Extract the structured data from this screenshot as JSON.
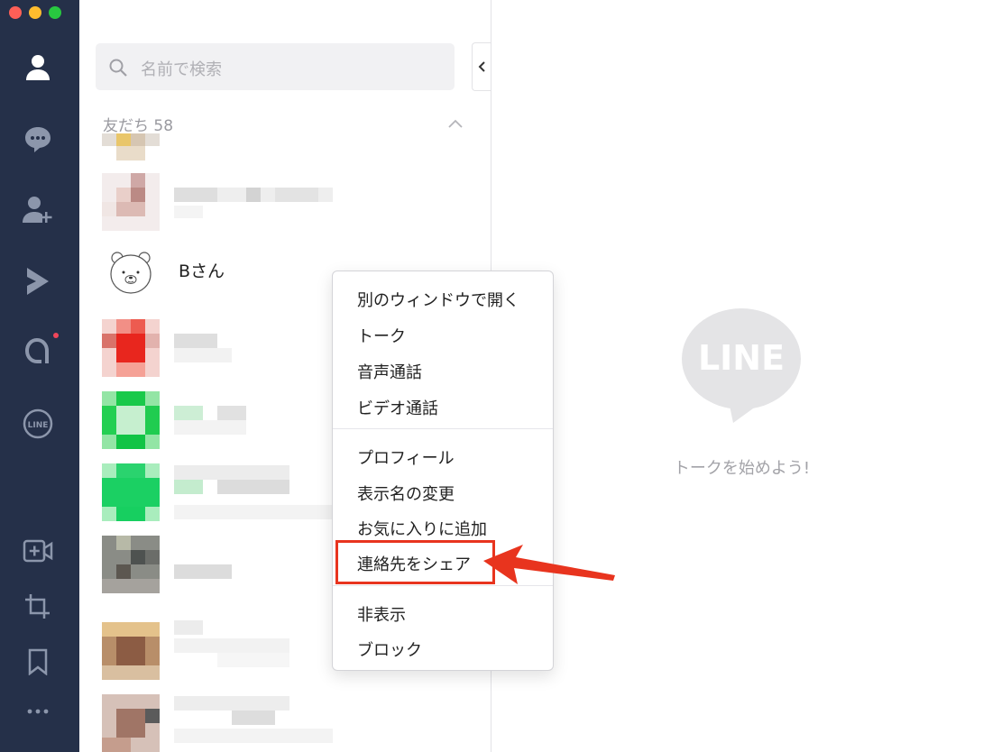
{
  "search": {
    "placeholder": "名前で検索"
  },
  "friends_section": {
    "label": "友だち 58"
  },
  "contact": {
    "name": "Bさん"
  },
  "context_menu": {
    "groups": [
      [
        "別のウィンドウで開く",
        "トーク",
        "音声通話",
        "ビデオ通話"
      ],
      [
        "プロフィール",
        "表示名の変更",
        "お気に入りに追加",
        "連絡先をシェア"
      ],
      [
        "非表示",
        "ブロック"
      ]
    ],
    "highlighted": "連絡先をシェア"
  },
  "chat_panel": {
    "logo_text": "LINE",
    "empty_message": "トークを始めよう!"
  },
  "colors": {
    "sidebar": "#253049",
    "highlight": "#e8341e",
    "logo": "#e4e4e6"
  },
  "sidebar_icons": [
    "friends-icon",
    "chats-icon",
    "add-friends-icon",
    "timeline-icon",
    "today-icon",
    "line-official-icon",
    "video-call-icon",
    "screenshot-crop-icon",
    "keep-bookmark-icon",
    "more-icon"
  ]
}
